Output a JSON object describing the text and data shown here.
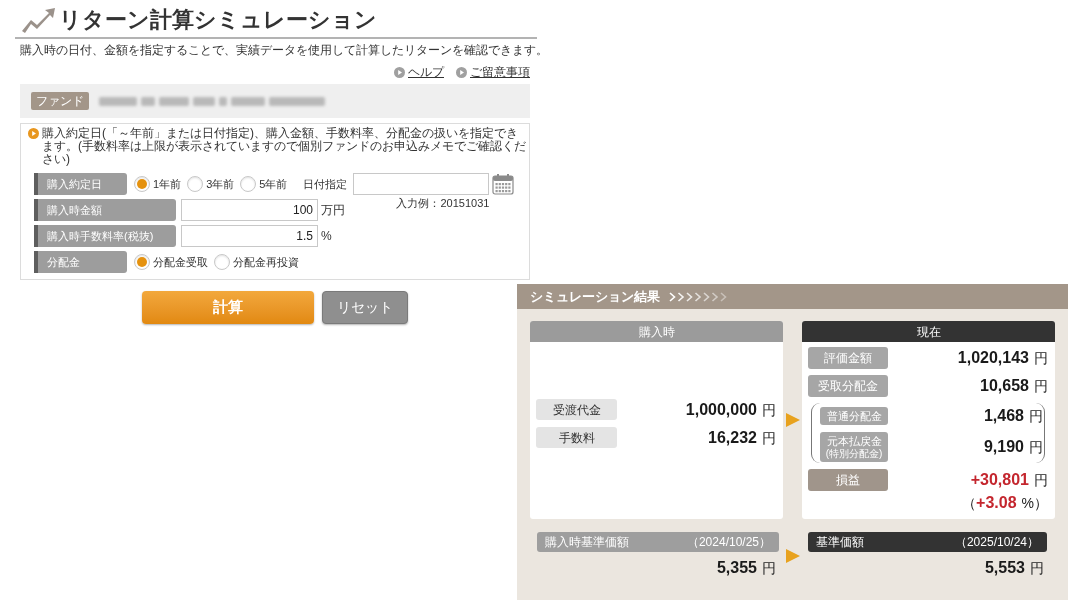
{
  "header": {
    "title": "リターン計算シミュレーション",
    "description": "購入時の日付、金額を指定することで、実績データを使用して計算したリターンを確認できます。"
  },
  "links": [
    {
      "label": "ヘルプ"
    },
    {
      "label": "ご留意事項"
    }
  ],
  "fund": {
    "label": "ファンド"
  },
  "form": {
    "note": "購入約定日(「～年前」または日付指定)、購入金額、手数料率、分配金の扱いを指定できます。(手数料率は上限が表示されていますので個別ファンドのお申込みメモでご確認ください)",
    "rows": [
      {
        "kind": "radio",
        "label": "購入約定日",
        "options": [
          {
            "label": "1年前",
            "selected": true
          },
          {
            "label": "3年前",
            "selected": false
          },
          {
            "label": "5年前",
            "selected": false
          }
        ],
        "date": {
          "label": "日付指定",
          "hint": "入力例：20151031"
        }
      },
      {
        "kind": "input",
        "label": "購入時金額",
        "value": "100",
        "unit": "万円"
      },
      {
        "kind": "input",
        "label": "購入時手数料率(税抜)",
        "value": "1.5",
        "unit": "%"
      },
      {
        "kind": "radio",
        "label": "分配金",
        "options": [
          {
            "label": "分配金受取",
            "selected": true
          },
          {
            "label": "分配金再投資",
            "selected": false
          }
        ]
      }
    ]
  },
  "buttons": [
    {
      "kind": "primary",
      "label": "計算"
    },
    {
      "kind": "secondary",
      "label": "リセット"
    }
  ],
  "results": {
    "title": "シミュレーション結果",
    "purchase": {
      "heading": "購入時",
      "items": [
        {
          "label": "受渡代金",
          "amount": "1,000,000",
          "unit": "円"
        },
        {
          "label": "手数料",
          "amount": "16,232",
          "unit": "円"
        }
      ]
    },
    "current": {
      "heading": "現在",
      "items": [
        {
          "label": "評価金額",
          "amount": "1,020,143",
          "unit": "円"
        },
        {
          "label": "受取分配金",
          "amount": "10,658",
          "unit": "円"
        }
      ],
      "breakdown": [
        {
          "label": "普通分配金",
          "amount": "1,468",
          "unit": "円"
        },
        {
          "label": "元本払戻金",
          "sublabel": "(特別分配金)",
          "amount": "9,190",
          "unit": "円"
        }
      ],
      "profit": {
        "label": "損益",
        "amount": "+30,801",
        "unit": "円",
        "rate_prefix": "（",
        "rate": "+3.08",
        "rate_suffix": "%）"
      }
    },
    "prices": [
      {
        "kind": "past",
        "label": "購入時基準価額",
        "date": "（2024/10/25）",
        "amount": "5,355",
        "unit": "円"
      },
      {
        "kind": "current",
        "label": "基準価額",
        "date": "（2025/10/24）",
        "amount": "5,553",
        "unit": "円"
      }
    ]
  }
}
